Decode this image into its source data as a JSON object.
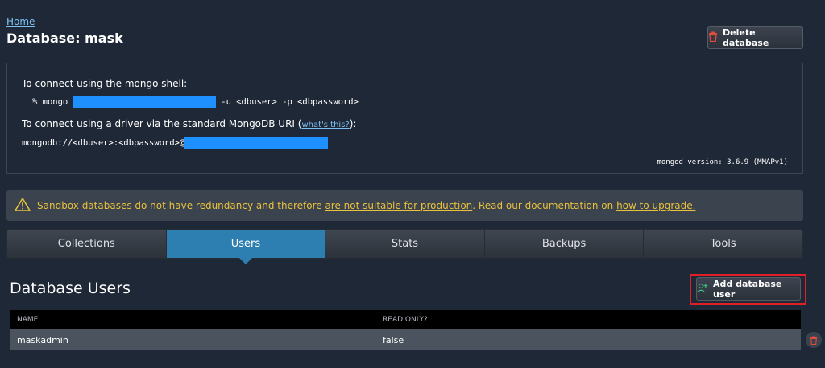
{
  "breadcrumb": {
    "home": "Home"
  },
  "page": {
    "title": "Database: mask"
  },
  "toolbar": {
    "delete_label": "Delete database"
  },
  "connect": {
    "shell_label": "To connect using the mongo shell:",
    "shell_prefix": "% mongo",
    "shell_suffix": "-u <dbuser> -p <dbpassword>",
    "driver_label": "To connect using a driver via the standard MongoDB URI (",
    "whats_this": "what's this?",
    "driver_label_end": "):",
    "uri_prefix": "mongodb://<dbuser>:<dbpassword>@",
    "version": "mongod version: 3.6.9 (MMAPv1)"
  },
  "warning": {
    "text1": "Sandbox databases do not have redundancy and therefore ",
    "link1": "are not suitable for production",
    "text2": ". Read our documentation on ",
    "link2": "how to upgrade."
  },
  "tabs": [
    "Collections",
    "Users",
    "Stats",
    "Backups",
    "Tools"
  ],
  "active_tab": "Users",
  "users_section": {
    "title": "Database Users",
    "add_label": "Add database user",
    "columns": [
      "NAME",
      "READ ONLY?"
    ],
    "rows": [
      {
        "name": "maskadmin",
        "read_only": "false"
      }
    ]
  },
  "colors": {
    "background": "#1f2836",
    "active_tab": "#2e7fb1",
    "warning_text": "#e9c13d",
    "redaction": "#1e90ff",
    "highlight": "#e21f26",
    "delete_icon": "#e34b3a",
    "add_icon": "#3fbf7f"
  },
  "icons": {
    "delete": "trash-icon",
    "warning": "warning-triangle-icon",
    "add_user": "add-user-icon",
    "row_delete": "trash-icon"
  }
}
